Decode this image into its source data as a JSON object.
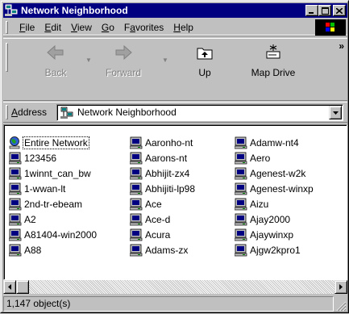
{
  "window": {
    "title": "Network Neighborhood",
    "caption_buttons": [
      "minimize",
      "maximize",
      "close"
    ]
  },
  "menu": {
    "items": [
      {
        "label": "File",
        "accel": "F",
        "rest": "ile"
      },
      {
        "label": "Edit",
        "accel": "E",
        "rest": "dit"
      },
      {
        "label": "View",
        "accel": "V",
        "rest": "iew"
      },
      {
        "label": "Go",
        "accel": "G",
        "rest": "o"
      },
      {
        "label": "Favorites",
        "pre": "F",
        "accel": "a",
        "rest": "vorites"
      },
      {
        "label": "Help",
        "accel": "H",
        "rest": "elp"
      }
    ]
  },
  "toolbar": {
    "back_label": "Back",
    "forward_label": "Forward",
    "up_label": "Up",
    "map_drive_label": "Map Drive",
    "more_glyph": "»"
  },
  "address": {
    "label_accel": "A",
    "label_rest": "ddress",
    "value": "Network Neighborhood"
  },
  "items": {
    "col1": [
      "Entire Network",
      "123456",
      "1winnt_can_bw",
      "1-wwan-lt",
      "2nd-tr-ebeam",
      "A2",
      "A81404-win2000",
      "A88"
    ],
    "col2": [
      "Aaronho-nt",
      "Aarons-nt",
      "Abhijit-zx4",
      "Abhijiti-lp98",
      "Ace",
      "Ace-d",
      "Acura",
      "Adams-zx"
    ],
    "col3": [
      "Adamw-nt4",
      "Aero",
      "Agenest-w2k",
      "Agenest-winxp",
      "Aizu",
      "Ajay2000",
      "Ajaywinxp",
      "Ajgw2kpro1"
    ]
  },
  "status": {
    "text": "1,147 object(s)"
  },
  "icons": {
    "network": "entire-network-icon",
    "computer": "computer-icon"
  },
  "colors": {
    "title_bar": "#000080",
    "face": "#c0c0c0",
    "content_bg": "#ffffff"
  }
}
